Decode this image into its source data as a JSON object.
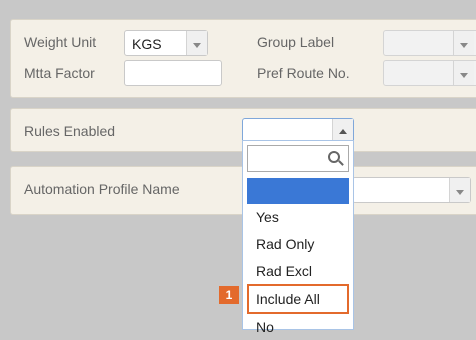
{
  "fields": {
    "weight_unit_label": "Weight Unit",
    "weight_unit_value": "KGS",
    "group_label_label": "Group Label",
    "group_label_value": "",
    "mtta_factor_label": "Mtta Factor",
    "mtta_factor_value": "",
    "pref_route_label": "Pref Route No.",
    "pref_route_value": "",
    "rules_enabled_label": "Rules Enabled",
    "rules_enabled_value": "",
    "automation_profile_label": "Automation Profile Name",
    "automation_profile_value": ""
  },
  "dropdown": {
    "search_value": "",
    "options": [
      "",
      "Yes",
      "Rad Only",
      "Rad Excl",
      "Include All",
      "No"
    ],
    "highlighted_index": 0,
    "marked_index": 4,
    "badge": "1"
  },
  "colors": {
    "highlight": "#3a78d6",
    "marker": "#e36a2c",
    "panel": "#f4f0e7",
    "background": "#c8c8c8"
  },
  "icons": [
    "chevron-down-icon",
    "chevron-up-icon",
    "search-icon"
  ]
}
